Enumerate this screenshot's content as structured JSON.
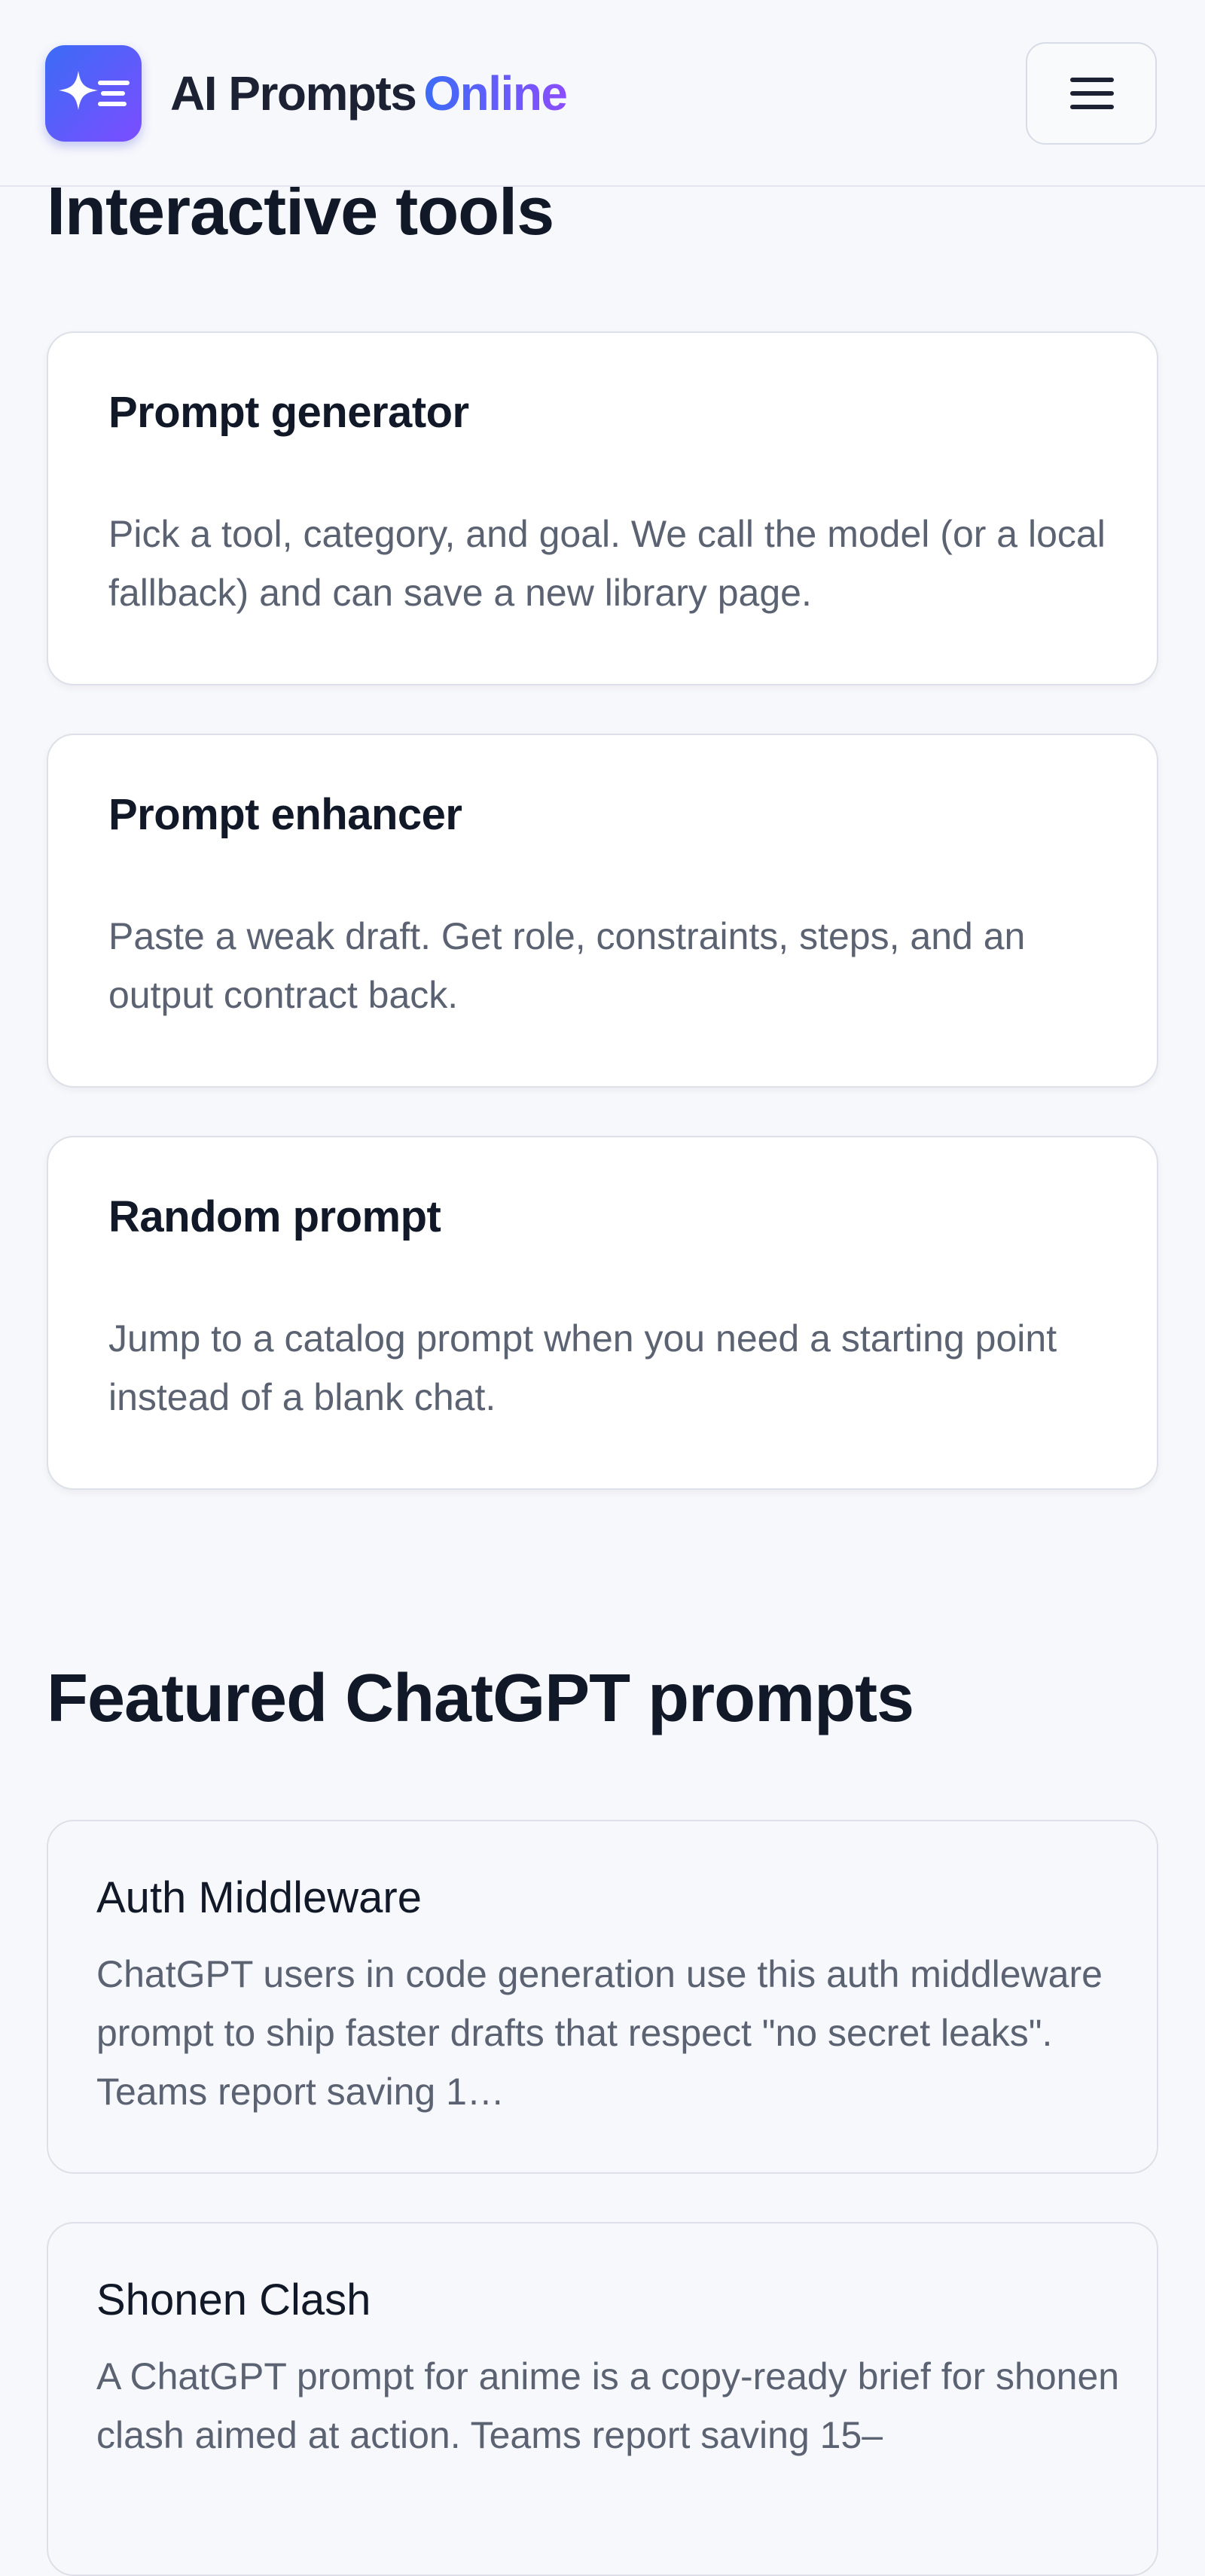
{
  "header": {
    "brand_main": "AI Prompts",
    "brand_accent": "Online",
    "logo_icon": "sparkle-lines-icon",
    "menu_icon": "hamburger-menu-icon"
  },
  "tools_section": {
    "title": "Interactive tools",
    "cards": [
      {
        "title": "Prompt generator",
        "description": "Pick a tool, category, and goal. We call the model (or a local fallback) and can save a new library page."
      },
      {
        "title": "Prompt enhancer",
        "description": "Paste a weak draft. Get role, constraints, steps, and an output contract back."
      },
      {
        "title": "Random prompt",
        "description": "Jump to a catalog prompt when you need a starting point instead of a blank chat."
      }
    ]
  },
  "featured_section": {
    "title": "Featured ChatGPT prompts",
    "cards": [
      {
        "title": "Auth Middleware",
        "description": "ChatGPT users in code generation use this auth middleware prompt to ship faster drafts that respect \"no secret leaks\". Teams report saving 1…"
      },
      {
        "title": "Shonen Clash",
        "description": "A ChatGPT prompt for anime is a copy-ready brief for shonen clash aimed at action. Teams report saving 15–"
      }
    ]
  },
  "colors": {
    "accent_start": "#3b6cf6",
    "accent_end": "#8b4dff",
    "page_background": "#f7f8fc",
    "heading_text": "#111827",
    "body_text": "#5b6272"
  }
}
